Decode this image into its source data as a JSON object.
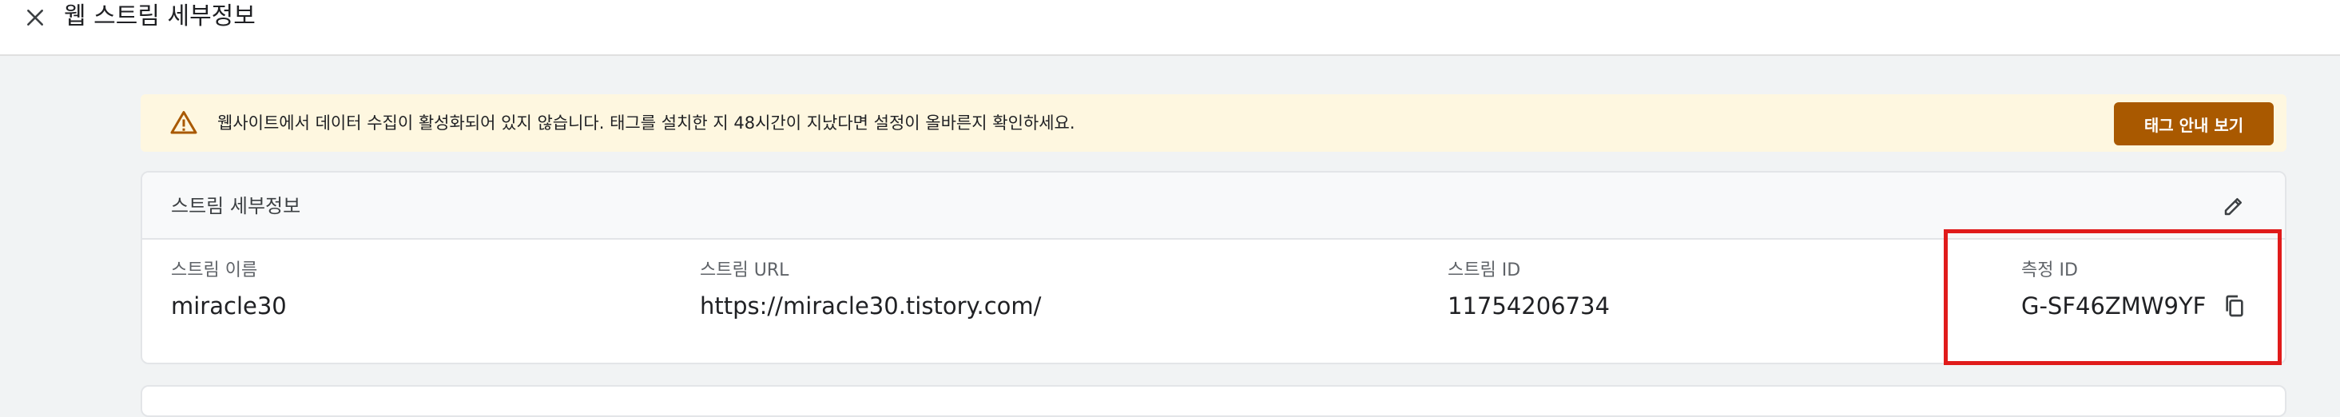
{
  "header": {
    "title": "웹 스트림 세부정보",
    "close_icon": "close-icon"
  },
  "banner": {
    "icon": "warning-icon",
    "text": "웹사이트에서 데이터 수집이 활성화되어 있지 않습니다. 태그를 설치한 지 48시간이 지났다면 설정이 올바른지 확인하세요.",
    "button_label": "태그 안내 보기",
    "background_color": "#fef7e0",
    "button_color": "#a95900",
    "icon_color": "#a95900"
  },
  "stream_details": {
    "title": "스트림 세부정보",
    "edit_icon": "edit-pencil-icon",
    "fields": [
      {
        "label": "스트림 이름",
        "value": "miracle30"
      },
      {
        "label": "스트림 URL",
        "value": "https://miracle30.tistory.com/"
      },
      {
        "label": "스트림 ID",
        "value": "11754206734"
      },
      {
        "label": "측정 ID",
        "value": "G-SF46ZMW9YF",
        "copy_icon": "copy-icon"
      }
    ]
  },
  "annotation": {
    "highlight_color": "#e01b1b"
  }
}
